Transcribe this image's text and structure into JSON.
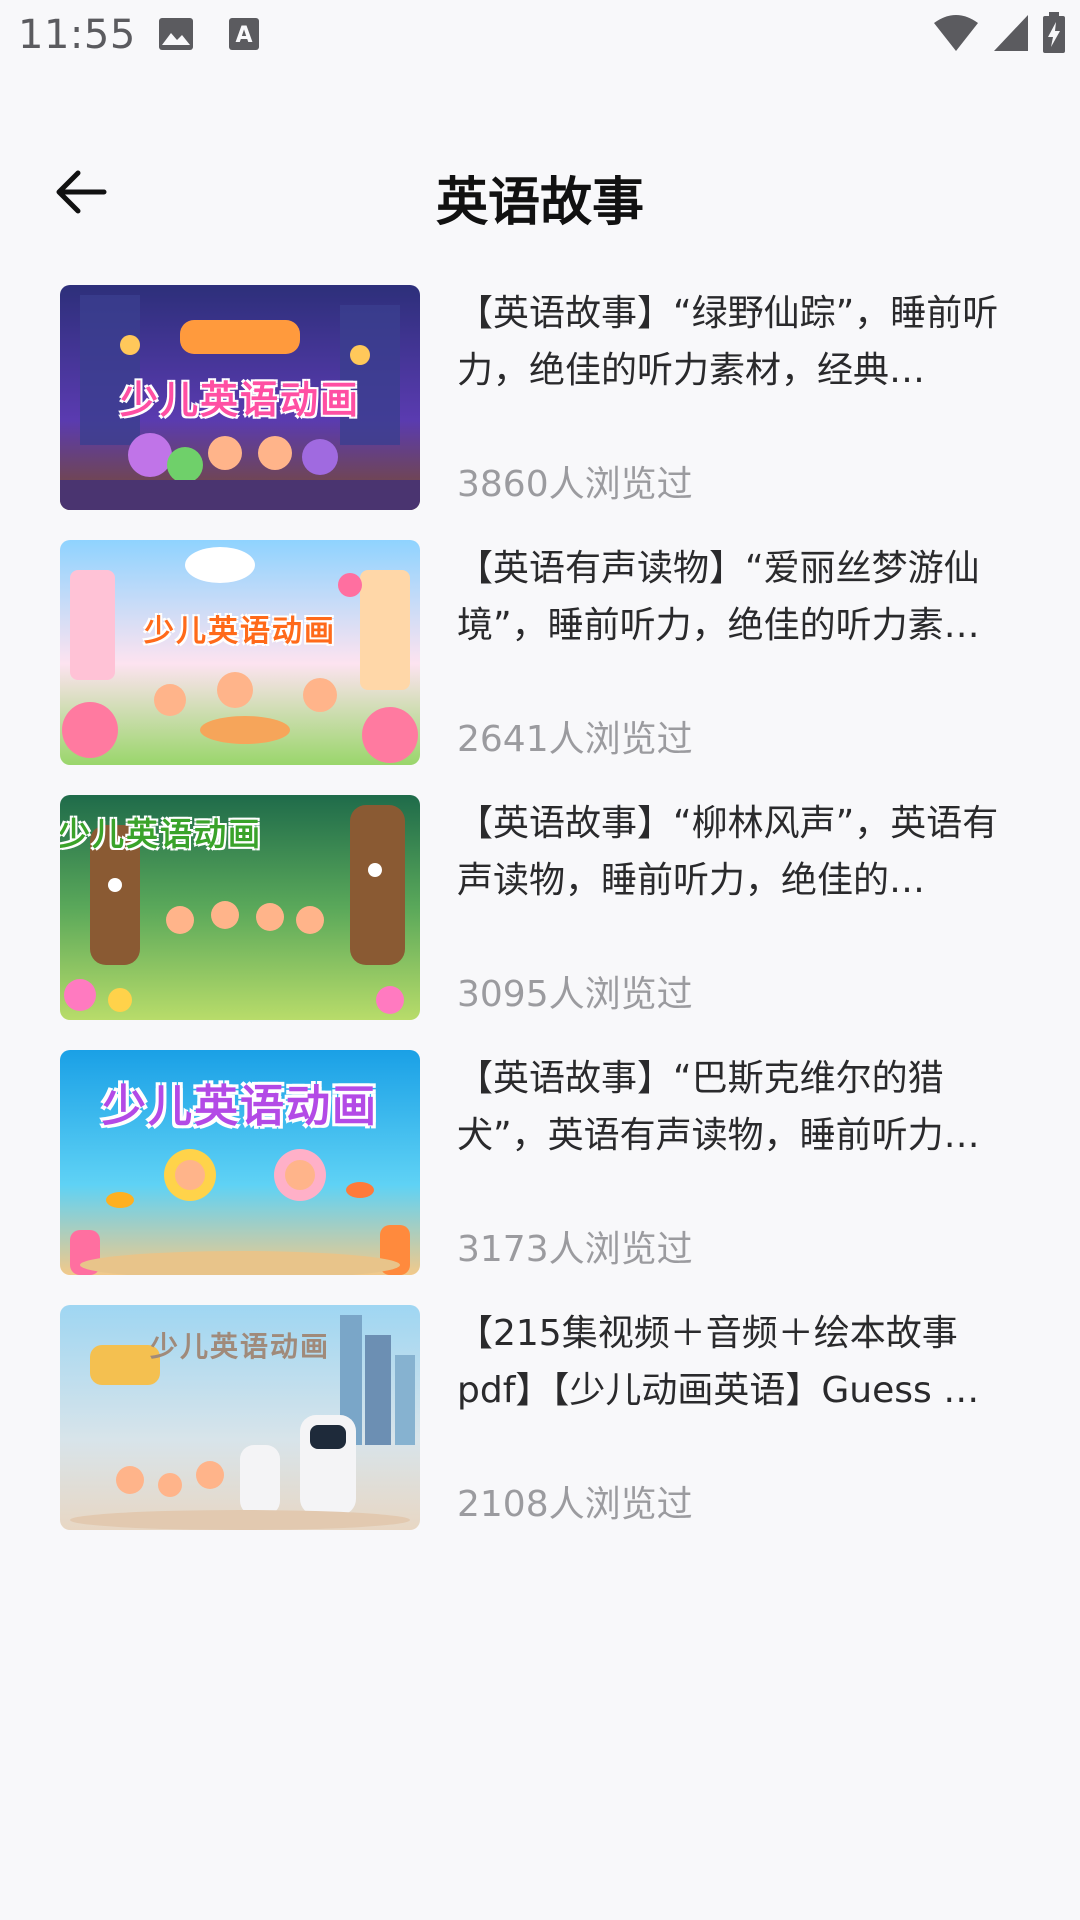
{
  "status_bar": {
    "time": "11:55",
    "left_icons": [
      "image-icon",
      "text-badge-icon"
    ],
    "right_icons": [
      "wifi-icon",
      "cell-signal-icon",
      "battery-charging-icon"
    ]
  },
  "header": {
    "title": "英语故事",
    "back_icon": "arrow-left-icon"
  },
  "stories": [
    {
      "title": "【英语故事】“绿野仙踪”，睡前听力，绝佳的听力素材，经典…",
      "views": "3860人浏览过",
      "thumb_text": "少儿英语动画",
      "thumb_colors": [
        "#3a2f8f",
        "#6a3fb8",
        "#ff5fa8"
      ]
    },
    {
      "title": "【英语有声读物】“爱丽丝梦游仙境”，睡前听力，绝佳的听力素…",
      "views": "2641人浏览过",
      "thumb_text": "少儿英语动画",
      "thumb_colors": [
        "#8fd3ff",
        "#ffd6e8",
        "#ff8a3d"
      ]
    },
    {
      "title": "【英语故事】“柳林风声”，英语有声读物，睡前听力，绝佳的…",
      "views": "3095人浏览过",
      "thumb_text": "少儿英语动画",
      "thumb_colors": [
        "#2f8a4a",
        "#7cc35b",
        "#f9e16b"
      ]
    },
    {
      "title": "【英语故事】“巴斯克维尔的猎犬”，英语有声读物，睡前听力…",
      "views": "3173人浏览过",
      "thumb_text": "少儿英语动画",
      "thumb_colors": [
        "#1aa6e8",
        "#5fd2f5",
        "#ff6fa0"
      ]
    },
    {
      "title": "【215集视频＋音频＋绘本故事pdf】【少儿动画英语】Guess …",
      "views": "2108人浏览过",
      "thumb_text": "少儿英语动画",
      "thumb_colors": [
        "#9fd6f2",
        "#e8d7c4",
        "#6c8fb3"
      ]
    }
  ]
}
